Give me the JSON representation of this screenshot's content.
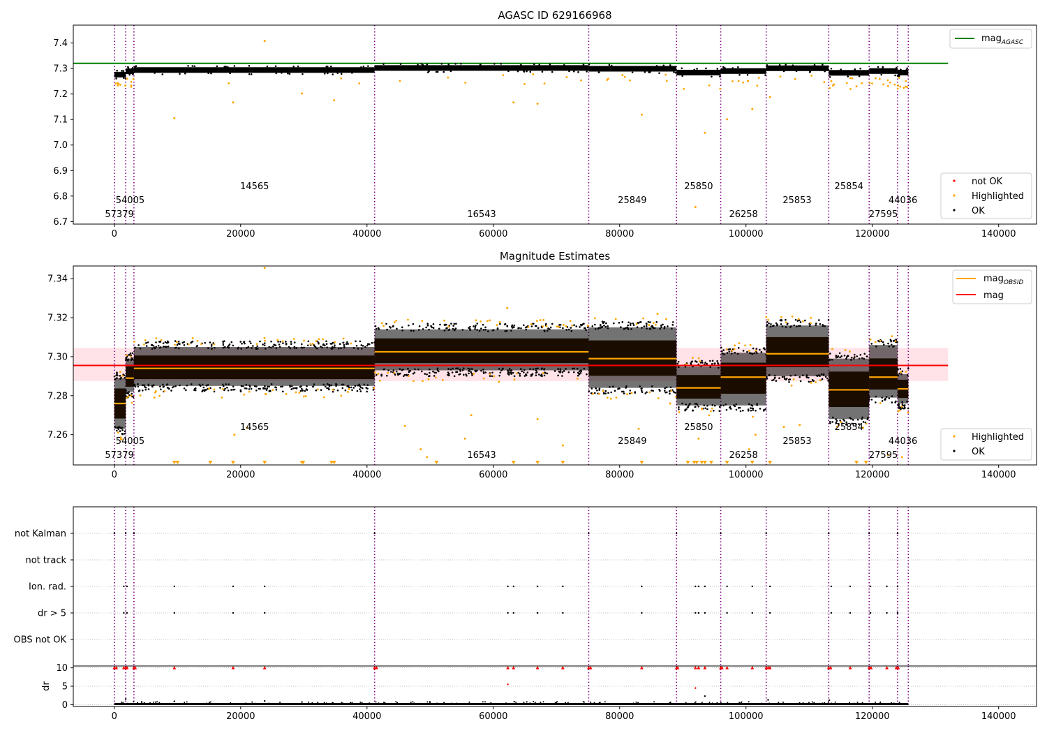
{
  "figure": {
    "x_ticks": [
      0,
      20000,
      40000,
      60000,
      80000,
      100000,
      120000,
      140000
    ],
    "xlim": [
      -6500,
      146000
    ],
    "obsid_boundaries": [
      0,
      1800,
      3100,
      41200,
      75100,
      89000,
      96000,
      103200,
      113100,
      119500,
      124000,
      125700
    ],
    "obsid_labels": [
      {
        "text": "57379",
        "x": 800,
        "row": 0
      },
      {
        "text": "54005",
        "x": 2500,
        "row": 1
      },
      {
        "text": "14565",
        "x": 22200,
        "row": 2
      },
      {
        "text": "16543",
        "x": 58150,
        "row": 0
      },
      {
        "text": "25849",
        "x": 82000,
        "row": 1
      },
      {
        "text": "25850",
        "x": 92500,
        "row": 2
      },
      {
        "text": "26258",
        "x": 99600,
        "row": 0
      },
      {
        "text": "25853",
        "x": 108100,
        "row": 1
      },
      {
        "text": "25854",
        "x": 116300,
        "row": 2
      },
      {
        "text": "27595",
        "x": 121750,
        "row": 0
      },
      {
        "text": "44036",
        "x": 124850,
        "row": 1
      }
    ],
    "colors": {
      "ok": "#000000",
      "highlighted": "#ffa500",
      "not_ok": "#ff0000",
      "agasc_line": "#008000",
      "mag_line": "#ff0000",
      "obsid_line": "#ffa500",
      "boundary": "#800080",
      "band": "#ffc0cb"
    }
  },
  "chart_data": [
    {
      "type": "scatter",
      "title": "AGASC ID 629166968",
      "ylim": [
        6.69,
        7.47
      ],
      "y_ticks": [
        "6.7",
        "6.8",
        "6.9",
        "7.0",
        "7.1",
        "7.2",
        "7.3",
        "7.4"
      ],
      "agasc_mag": 7.32,
      "legend_upper": {
        "position": "upper-right",
        "entry_main": "mag",
        "entry_sub": "AGASC"
      },
      "legend_lower": {
        "position": "lower-right",
        "entries": [
          "not OK",
          "Highlighted",
          "OK"
        ]
      },
      "segments": [
        {
          "x0": 0,
          "x1": 1800,
          "level": 7.276
        },
        {
          "x0": 1800,
          "x1": 3100,
          "level": 7.289
        },
        {
          "x0": 3100,
          "x1": 41200,
          "level": 7.294
        },
        {
          "x0": 41200,
          "x1": 75100,
          "level": 7.302
        },
        {
          "x0": 75100,
          "x1": 89000,
          "level": 7.299
        },
        {
          "x0": 89000,
          "x1": 96000,
          "level": 7.284
        },
        {
          "x0": 96000,
          "x1": 103200,
          "level": 7.29
        },
        {
          "x0": 103200,
          "x1": 113100,
          "level": 7.301
        },
        {
          "x0": 113100,
          "x1": 119500,
          "level": 7.283
        },
        {
          "x0": 119500,
          "x1": 124000,
          "level": 7.29
        },
        {
          "x0": 124000,
          "x1": 125700,
          "level": 7.284
        }
      ],
      "highlighted_points": [
        [
          9500,
          7.105
        ],
        [
          18800,
          7.167
        ],
        [
          23800,
          7.408
        ],
        [
          29700,
          7.202
        ],
        [
          34800,
          7.175
        ],
        [
          63200,
          7.167
        ],
        [
          67000,
          7.162
        ],
        [
          83500,
          7.119
        ],
        [
          92000,
          6.757
        ],
        [
          93500,
          7.048
        ],
        [
          97000,
          7.101
        ],
        [
          101000,
          7.141
        ],
        [
          103800,
          7.188
        ],
        [
          117500,
          7.23
        ]
      ]
    },
    {
      "type": "scatter",
      "title": "Magnitude Estimates",
      "ylim": [
        7.2445,
        7.3465
      ],
      "y_ticks": [
        "7.26",
        "7.28",
        "7.30",
        "7.32",
        "7.34"
      ],
      "mag": 7.2955,
      "mag_band": [
        7.2875,
        7.3045
      ],
      "legend_upper": {
        "position": "upper-right",
        "entry_obsid_main": "mag",
        "entry_obsid_sub": "OBSID",
        "entry_mag": "mag"
      },
      "legend_lower": {
        "position": "lower-right",
        "entries": [
          "Highlighted",
          "OK"
        ]
      },
      "segments": [
        {
          "x0": 0,
          "x1": 1800,
          "level": 7.276,
          "lo": 7.262,
          "hi": 7.29
        },
        {
          "x0": 1800,
          "x1": 3100,
          "level": 7.289,
          "lo": 7.281,
          "hi": 7.3
        },
        {
          "x0": 3100,
          "x1": 41200,
          "level": 7.294,
          "lo": 7.284,
          "hi": 7.306
        },
        {
          "x0": 41200,
          "x1": 75100,
          "level": 7.3025,
          "lo": 7.292,
          "hi": 7.315
        },
        {
          "x0": 75100,
          "x1": 89000,
          "level": 7.299,
          "lo": 7.283,
          "hi": 7.316
        },
        {
          "x0": 89000,
          "x1": 96000,
          "level": 7.284,
          "lo": 7.274,
          "hi": 7.296
        },
        {
          "x0": 96000,
          "x1": 103200,
          "level": 7.2895,
          "lo": 7.274,
          "hi": 7.303
        },
        {
          "x0": 103200,
          "x1": 113100,
          "level": 7.3015,
          "lo": 7.289,
          "hi": 7.317
        },
        {
          "x0": 113100,
          "x1": 119500,
          "level": 7.283,
          "lo": 7.267,
          "hi": 7.3
        },
        {
          "x0": 119500,
          "x1": 124000,
          "level": 7.2895,
          "lo": 7.278,
          "hi": 7.307
        },
        {
          "x0": 124000,
          "x1": 125700,
          "level": 7.2835,
          "lo": 7.275,
          "hi": 7.292
        }
      ],
      "highlighted_points": [
        [
          19000,
          7.26
        ],
        [
          21000,
          7.2635
        ],
        [
          23800,
          7.3455
        ],
        [
          46000,
          7.2645
        ],
        [
          48500,
          7.2525
        ],
        [
          49500,
          7.2485
        ],
        [
          55500,
          7.258
        ],
        [
          56500,
          7.27
        ],
        [
          62200,
          7.325
        ],
        [
          67000,
          7.268
        ],
        [
          71000,
          7.2545
        ],
        [
          83000,
          7.263
        ],
        [
          86000,
          7.322
        ],
        [
          88000,
          7.276
        ],
        [
          92500,
          7.258
        ],
        [
          100500,
          7.2525
        ],
        [
          101500,
          7.26
        ],
        [
          106000,
          7.264
        ],
        [
          108500,
          7.265
        ],
        [
          122500,
          7.2495
        ],
        [
          124700,
          7.2485
        ]
      ],
      "clipped_markers_x": [
        9500,
        10000,
        15200,
        18800,
        23800,
        29700,
        29900,
        34400,
        34800,
        51000,
        63200,
        67000,
        71000,
        83500,
        90800,
        91800,
        92200,
        93000,
        93500,
        94500,
        97000,
        101000,
        103800,
        117500,
        119000
      ]
    },
    {
      "type": "scatter",
      "title": "",
      "flag_rows": [
        "not Kalman",
        "not track",
        "Ion. rad.",
        "dr > 5",
        "OBS not OK"
      ],
      "flag_points": {
        "not Kalman": [
          0,
          1800,
          3100,
          41200,
          75100,
          89000,
          96000,
          103200,
          113100,
          119500,
          124000
        ],
        "not track": [],
        "Ion. rad.": [
          1500,
          2000,
          9500,
          18800,
          23800,
          62300,
          63200,
          67000,
          71000,
          83500,
          92000,
          92500,
          93500,
          97000,
          101000,
          103800,
          113500,
          116500,
          119700,
          122300,
          124000
        ],
        "dr > 5": [
          1500,
          2000,
          9500,
          18800,
          23800,
          62300,
          63200,
          67000,
          71000,
          83500,
          92000,
          92500,
          93500,
          97000,
          101000,
          103800,
          113500,
          116500,
          119700,
          122300,
          124000
        ],
        "OBS not OK": []
      }
    },
    {
      "type": "scatter",
      "title": "",
      "ylabel": "dr",
      "ylim": [
        -0.5,
        10.5
      ],
      "y_ticks": [
        "0",
        "5",
        "10"
      ],
      "red_points_x": [
        0,
        300,
        1500,
        1800,
        2000,
        3100,
        3300,
        9500,
        18800,
        23800,
        41200,
        41500,
        62300,
        63200,
        67000,
        71000,
        75100,
        75400,
        83500,
        89000,
        89200,
        92000,
        92500,
        93500,
        96000,
        96200,
        97000,
        101000,
        103200,
        103500,
        103800,
        113100,
        113400,
        116500,
        119500,
        119800,
        122300,
        123800,
        124100
      ],
      "red_low_points": [
        [
          62300,
          5.5
        ],
        [
          92000,
          4.5
        ]
      ],
      "black_high_points": [
        [
          1800,
          1.5
        ],
        [
          9500,
          0.9
        ],
        [
          23800,
          1.0
        ],
        [
          29700,
          0.7
        ],
        [
          63300,
          0.8
        ],
        [
          93500,
          2.3
        ],
        [
          103500,
          1.3
        ],
        [
          113200,
          1.2
        ]
      ]
    }
  ]
}
